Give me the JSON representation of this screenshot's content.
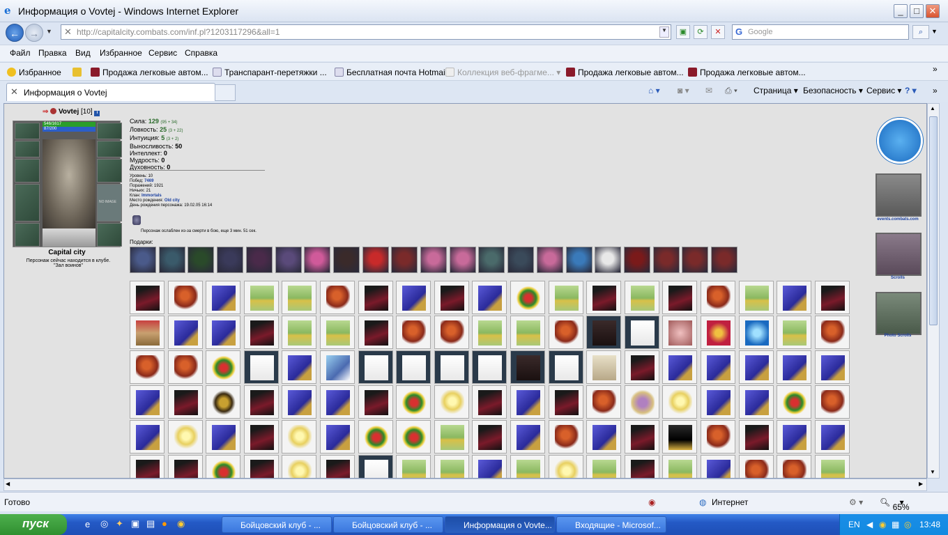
{
  "window": {
    "title": "Информация о Vovtej - Windows Internet Explorer"
  },
  "address": {
    "url": "http://capitalcity.combats.com/inf.pl?1203117296&all=1",
    "search_placeholder": "Google"
  },
  "menu": [
    "Файл",
    "Правка",
    "Вид",
    "Избранное",
    "Сервис",
    "Справка"
  ],
  "favorites": {
    "label": "Избранное",
    "items": [
      "Продажа легковые автом...",
      "Транспарант-перетяжки ...",
      "Бесплатная почта Hotmail",
      "Коллекция веб-фрагме...",
      "Продажа легковые автом...",
      "Продажа легковые автом..."
    ]
  },
  "tab": {
    "label": "Информация о Vovtej"
  },
  "commands": {
    "page": "Страница",
    "security": "Безопасность",
    "service": "Сервис"
  },
  "character": {
    "name": "Vovtej",
    "level": "[10]",
    "hp": "546/1617",
    "mp": "87/200",
    "city": "Capital city",
    "location_line1": "Персонаж сейчас находится в клубе.",
    "location_line2": "\"Зал воинов\"",
    "no_image": "NO IMAGE"
  },
  "stats": [
    {
      "label": "Сила:",
      "value": "129",
      "extra": "(95 + 34)"
    },
    {
      "label": "Ловкость:",
      "value": "25",
      "extra": "(3 + 22)"
    },
    {
      "label": "Интуиция:",
      "value": "5",
      "extra": "(3 + 2)"
    },
    {
      "label": "Выносливость:",
      "value": "50",
      "extra": ""
    },
    {
      "label": "Интеллект:",
      "value": "0",
      "extra": ""
    },
    {
      "label": "Мудрость:",
      "value": "0",
      "extra": ""
    },
    {
      "label": "Духовность:",
      "value": "0",
      "extra": ""
    }
  ],
  "info": [
    {
      "label": "Уровень:",
      "value": "10"
    },
    {
      "label": "Побед:",
      "value": "7469"
    },
    {
      "label": "Поражений:",
      "value": "1921"
    },
    {
      "label": "Ничьих:",
      "value": "21"
    },
    {
      "label": "Клан:",
      "value": "Immortals"
    },
    {
      "label": "Место рождения:",
      "value": "Old city"
    },
    {
      "label": "День рождения персонажа:",
      "value": "19.02.05 16:14"
    }
  ],
  "death_note": "Персонаж ослаблен из-за смерти в бою, еще 3 мин. 51 сек.",
  "gifts_label": "Подарки:",
  "gift_colors": [
    "#4a5a8a",
    "#3a5a6a",
    "#2a4a2a",
    "#3a3a5a",
    "#4a2a4a",
    "#5a4a7a",
    "#d05a9a",
    "#3a2a2a",
    "#c82a2a",
    "#7a2a2a",
    "#c86a9a",
    "#c86a9a",
    "#4a6a6a",
    "#3a4a5a",
    "#c86a9a",
    "#3a7aba",
    "#e8e8e8",
    "#7a1a1a",
    "#7a2a2a",
    "#7a2a2a",
    "#7a2a2a"
  ],
  "item_rows": [
    [
      "bag",
      "red",
      "blue",
      "box",
      "box",
      "red",
      "bag",
      "blue",
      "bag",
      "blue",
      "green",
      "box",
      "bag",
      "box",
      "bag",
      "red",
      "box",
      "blue",
      "bag"
    ],
    [
      "basket",
      "blue",
      "blue",
      "bag",
      "box",
      "box",
      "bag",
      "red",
      "red",
      "box",
      "box",
      "red",
      "dark",
      "card",
      "pink",
      "heart",
      "blueheart",
      "box",
      "red"
    ],
    [
      "red",
      "red",
      "green",
      "card",
      "blue",
      "white",
      "card",
      "card",
      "card",
      "card",
      "dark",
      "card",
      "paper",
      "bag",
      "blue",
      "blue",
      "blue",
      "blue",
      "blue"
    ],
    [
      "blue",
      "bag",
      "egg",
      "bag",
      "blue",
      "blue",
      "bag",
      "green",
      "yellow",
      "bag",
      "blue",
      "bag",
      "red",
      "flower",
      "yellow",
      "blue",
      "blue",
      "green",
      "red"
    ],
    [
      "blue",
      "yellow",
      "blue",
      "bag",
      "yellow",
      "blue",
      "green",
      "green",
      "box",
      "bag",
      "blue",
      "red",
      "blue",
      "bag",
      "chest",
      "red",
      "bag",
      "blue",
      "blue"
    ],
    [
      "bag",
      "bag",
      "green",
      "bag",
      "yellow",
      "bag",
      "card",
      "box",
      "box",
      "blue",
      "box",
      "yellow",
      "box",
      "bag",
      "box",
      "blue",
      "red",
      "red",
      "box"
    ]
  ],
  "right_icons": [
    {
      "label": "events.combats.com"
    },
    {
      "label": "Scrolls"
    },
    {
      "label": "Photo Scrolls"
    }
  ],
  "status": {
    "ready": "Готово",
    "zone": "Интернет",
    "zoom": "65%"
  },
  "taskbar": {
    "start": "пуск",
    "tasks": [
      "Бойцовский клуб - ...",
      "Бойцовский клуб - ...",
      "Информация о Vovte...",
      "Входящие - Microsof..."
    ],
    "lang": "EN",
    "time": "13:48"
  },
  "colors": {
    "accent": "#1d5bb8",
    "taskbar": "#2459c5",
    "start": "#2f8f2f"
  }
}
